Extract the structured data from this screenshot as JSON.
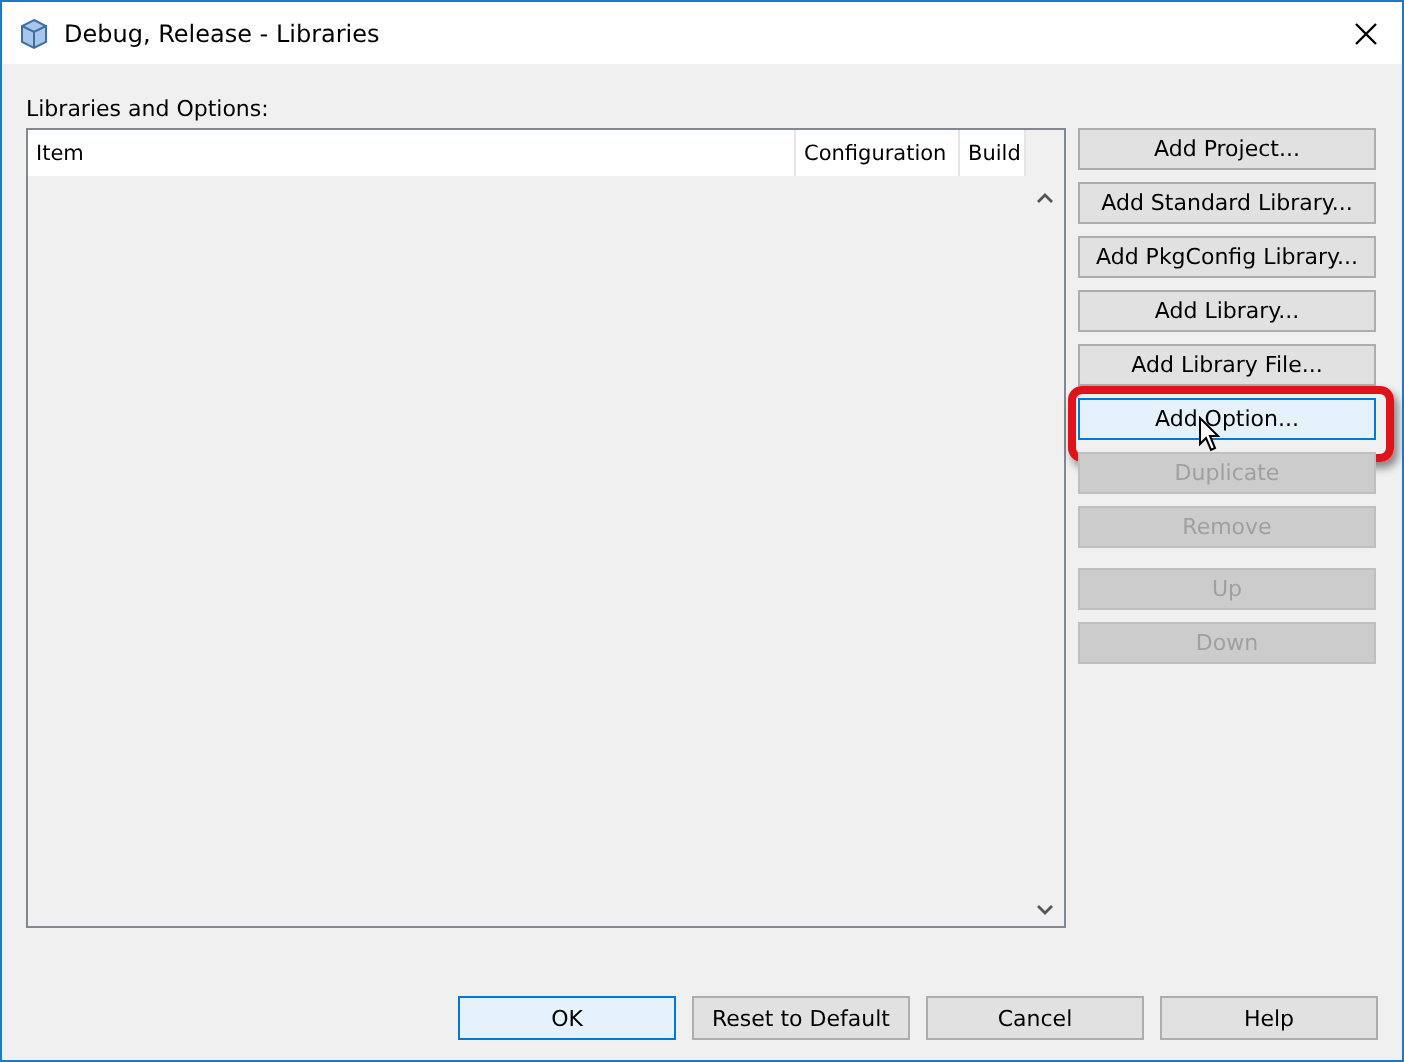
{
  "window": {
    "title": "Debug, Release - Libraries"
  },
  "list_label": "Libraries and Options:",
  "table": {
    "columns": [
      "Item",
      "Configuration",
      "Build"
    ]
  },
  "side_buttons": [
    {
      "label": "Add Project...",
      "disabled": false,
      "highlighted": false
    },
    {
      "label": "Add Standard Library...",
      "disabled": false,
      "highlighted": false
    },
    {
      "label": "Add PkgConfig Library...",
      "disabled": false,
      "highlighted": false
    },
    {
      "label": "Add Library...",
      "disabled": false,
      "highlighted": false
    },
    {
      "label": "Add Library File...",
      "disabled": false,
      "highlighted": false
    },
    {
      "label": "Add Option...",
      "disabled": false,
      "highlighted": true
    },
    {
      "label": "Duplicate",
      "disabled": true,
      "highlighted": false
    },
    {
      "label": "Remove",
      "disabled": true,
      "highlighted": false
    }
  ],
  "move_buttons": [
    {
      "label": "Up",
      "disabled": true
    },
    {
      "label": "Down",
      "disabled": true
    }
  ],
  "footer_buttons": [
    {
      "label": "OK",
      "default": true
    },
    {
      "label": "Reset to Default",
      "default": false
    },
    {
      "label": "Cancel",
      "default": false
    },
    {
      "label": "Help",
      "default": false
    }
  ]
}
